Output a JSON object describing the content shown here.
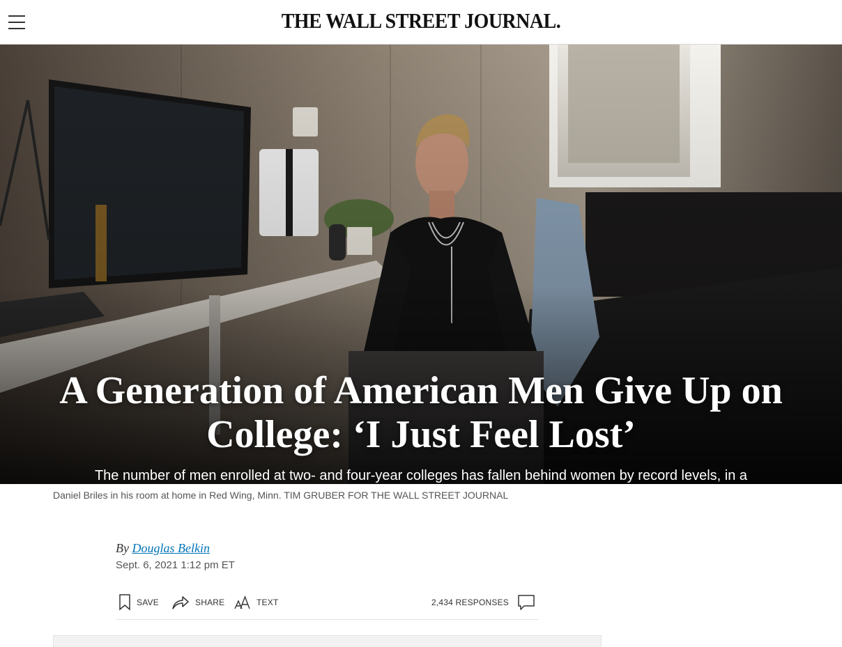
{
  "header": {
    "logo": "THE WALL STREET JOURNAL.",
    "menu_icon": "hamburger-menu-icon"
  },
  "hero": {
    "headline": "A Generation of American Men Give Up on College: ‘I Just Feel Lost’",
    "dek": "The number of men enrolled at two- and four-year colleges has fallen behind women by record levels, in a widening education gap across the U.S."
  },
  "caption": "Daniel Briles in his room at home in Red Wing, Minn. TIM GRUBER FOR THE WALL STREET JOURNAL",
  "byline": {
    "prefix": "By ",
    "author": "Douglas Belkin",
    "timestamp": "Sept. 6, 2021 1:12 pm ET"
  },
  "toolbar": {
    "save_label": "SAVE",
    "share_label": "SHARE",
    "text_label": "TEXT",
    "responses_label": "2,434 RESPONSES",
    "icons": [
      "bookmark-icon",
      "share-arrow-icon",
      "text-size-icon",
      "comment-bubble-icon"
    ]
  },
  "colors": {
    "link": "#0274b6",
    "text": "#111111",
    "muted": "#555555"
  }
}
